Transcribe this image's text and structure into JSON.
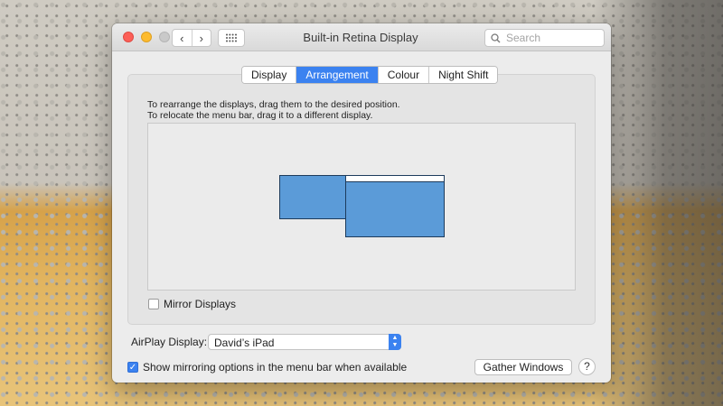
{
  "window": {
    "title": "Built-in Retina Display",
    "search_placeholder": "Search",
    "icons": {
      "back": "‹",
      "forward": "›"
    }
  },
  "tabs": [
    {
      "label": "Display",
      "active": false
    },
    {
      "label": "Arrangement",
      "active": true
    },
    {
      "label": "Colour",
      "active": false
    },
    {
      "label": "Night Shift",
      "active": false
    }
  ],
  "arrangement": {
    "instruction_line1": "To rearrange the displays, drag them to the desired position.",
    "instruction_line2": "To relocate the menu bar, drag it to a different display.",
    "display_color": "#5b9bd8"
  },
  "mirror_displays": {
    "label": "Mirror Displays",
    "checked": false
  },
  "airplay": {
    "label": "AirPlay Display:",
    "selected": "David’s iPad"
  },
  "show_mirroring": {
    "label": "Show mirroring options in the menu bar when available",
    "checked": true,
    "check_glyph": "✓"
  },
  "buttons": {
    "gather": "Gather Windows",
    "help": "?"
  },
  "colors": {
    "accent": "#3b82f0",
    "close": "#fc5f57",
    "minimize": "#fdbb2e",
    "zoom_disabled": "#c9c9c9"
  }
}
